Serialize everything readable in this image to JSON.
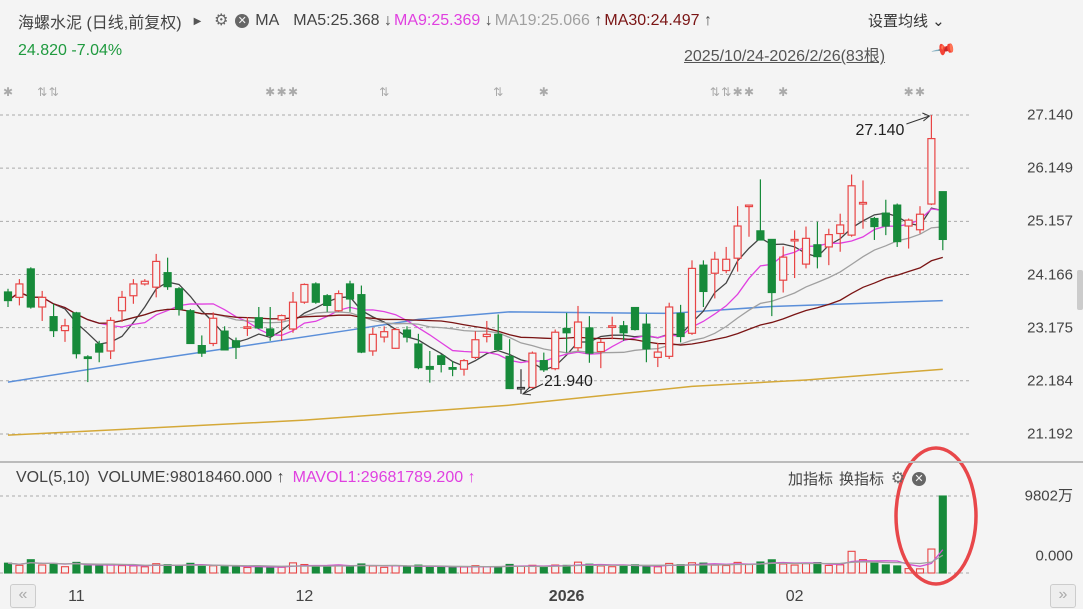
{
  "header": {
    "title": "海螺水泥 (日线,前复权)",
    "indicator": "MA",
    "ma_items": [
      {
        "label": "MA5:25.368",
        "arrow": "↓",
        "color": "#444444"
      },
      {
        "label": "MA9:25.369",
        "arrow": "↓",
        "color": "#e040e0"
      },
      {
        "label": "MA19:25.066",
        "arrow": "↑",
        "color": "#a0a0a0"
      },
      {
        "label": "MA30:24.497",
        "arrow": "↑",
        "color": "#7a1414"
      }
    ],
    "settings": "设置均线 ⌄"
  },
  "quote": {
    "price": "24.820",
    "change": "-7.04%"
  },
  "range": "2025/10/24-2026/2/26(83根)",
  "volume_panel": {
    "title": "VOL(5,10)",
    "volume": "VOLUME:98018460.000",
    "volume_arrow": "↑",
    "mavol": "MAVOL1:29681789.200",
    "mavol_arrow": "↑",
    "add_indicator": "加指标",
    "switch_indicator": "换指标",
    "max_label": "9802万",
    "zero_label": "0.000",
    "max_value": 98018460
  },
  "nav": {
    "prev": "«",
    "next": "»"
  },
  "chart_data": {
    "type": "candlestick",
    "ylim": [
      21.192,
      27.14
    ],
    "y_ticks": [
      "27.140",
      "26.149",
      "25.157",
      "24.166",
      "23.175",
      "22.184",
      "21.192"
    ],
    "x_ticks": [
      {
        "label": "11",
        "date": "2025-11-03"
      },
      {
        "label": "12",
        "date": "2025-12-01"
      },
      {
        "label": "2026",
        "date": "2026-01-05"
      },
      {
        "label": "02",
        "date": "2026-02-02"
      }
    ],
    "ma_periods": [
      5,
      9,
      19,
      30
    ],
    "mavol_periods": [
      5,
      10
    ],
    "colors": {
      "up": "#e84545",
      "down": "#178a3a",
      "ma5": "#444444",
      "ma9": "#e040e0",
      "ma19": "#a0a0a0",
      "ma30": "#7a1414",
      "long_blue": "#5b8fd9",
      "long_gold": "#d4a838",
      "mavol5": "#d050d0",
      "mavol10": "#a0a0a0",
      "highlight": "#e8474a"
    },
    "long_lines": [
      {
        "color": "#5b8fd9",
        "points": [
          [
            "2025-10-24",
            22.16
          ],
          [
            "2025-11-11",
            22.56
          ],
          [
            "2025-12-05",
            23.13
          ],
          [
            "2025-12-15",
            23.33
          ],
          [
            "2025-12-25",
            23.47
          ],
          [
            "2026-01-16",
            23.44
          ],
          [
            "2026-01-29",
            23.57
          ],
          [
            "2026-02-26",
            23.68
          ]
        ]
      },
      {
        "color": "#d4a838",
        "points": [
          [
            "2025-10-24",
            21.17
          ],
          [
            "2025-12-01",
            21.45
          ],
          [
            "2025-12-25",
            21.73
          ],
          [
            "2026-01-20",
            22.08
          ],
          [
            "2026-02-03",
            22.2
          ],
          [
            "2026-02-26",
            22.4
          ]
        ]
      }
    ],
    "annotations": [
      {
        "label": "27.140",
        "date": "2026-02-25",
        "kind": "high"
      },
      {
        "label": "21.940",
        "date": "2025-12-26",
        "kind": "low"
      }
    ],
    "markers": [
      {
        "type": "star",
        "date": "2025-10-24"
      },
      {
        "type": "updown",
        "date": "2025-10-29"
      },
      {
        "type": "updown",
        "date": "2025-10-30"
      },
      {
        "type": "star",
        "date": "2025-11-26"
      },
      {
        "type": "star",
        "date": "2025-11-27"
      },
      {
        "type": "star",
        "date": "2025-11-28"
      },
      {
        "type": "updown",
        "date": "2025-12-10"
      },
      {
        "type": "updown",
        "date": "2025-12-24"
      },
      {
        "type": "star",
        "date": "2025-12-30"
      },
      {
        "type": "updown",
        "date": "2026-01-22"
      },
      {
        "type": "updown",
        "date": "2026-01-23"
      },
      {
        "type": "star",
        "date": "2026-01-26"
      },
      {
        "type": "star",
        "date": "2026-01-27"
      },
      {
        "type": "star",
        "date": "2026-01-30"
      },
      {
        "type": "star",
        "date": "2026-02-23"
      },
      {
        "type": "star",
        "date": "2026-02-24"
      }
    ],
    "candles_fields": [
      "date",
      "open",
      "high",
      "low",
      "close",
      "volume"
    ],
    "candles": [
      [
        "2025-10-24",
        23.84,
        23.9,
        23.56,
        23.68,
        12500000
      ],
      [
        "2025-10-27",
        23.74,
        24.08,
        23.59,
        23.99,
        9800000
      ],
      [
        "2025-10-28",
        24.27,
        24.3,
        23.53,
        23.56,
        16900000
      ],
      [
        "2025-10-29",
        23.56,
        23.86,
        23.3,
        23.74,
        10200000
      ],
      [
        "2025-10-30",
        23.38,
        23.62,
        23.0,
        23.12,
        12100000
      ],
      [
        "2025-10-31",
        23.12,
        23.34,
        22.91,
        23.21,
        8000000
      ],
      [
        "2025-11-03",
        23.45,
        23.47,
        22.6,
        22.69,
        13500000
      ],
      [
        "2025-11-04",
        22.63,
        22.66,
        22.16,
        22.6,
        9100000
      ],
      [
        "2025-11-05",
        22.87,
        22.93,
        22.53,
        22.72,
        8800000
      ],
      [
        "2025-11-06",
        22.74,
        23.37,
        22.59,
        23.31,
        11000000
      ],
      [
        "2025-11-07",
        23.49,
        23.86,
        23.28,
        23.74,
        9400000
      ],
      [
        "2025-11-10",
        23.77,
        24.08,
        23.62,
        23.99,
        9000000
      ],
      [
        "2025-11-11",
        23.99,
        24.08,
        23.96,
        24.04,
        7900000
      ],
      [
        "2025-11-12",
        23.93,
        24.55,
        23.74,
        24.41,
        11800000
      ],
      [
        "2025-11-13",
        24.2,
        24.48,
        23.88,
        23.94,
        10600000
      ],
      [
        "2025-11-14",
        23.9,
        23.93,
        23.4,
        23.52,
        9500000
      ],
      [
        "2025-11-17",
        23.49,
        23.52,
        22.87,
        22.88,
        12300000
      ],
      [
        "2025-11-18",
        22.84,
        23.03,
        22.63,
        22.7,
        8600000
      ],
      [
        "2025-11-19",
        22.88,
        23.46,
        22.83,
        23.35,
        9200000
      ],
      [
        "2025-11-20",
        23.11,
        23.2,
        22.75,
        22.76,
        8100000
      ],
      [
        "2025-11-21",
        22.93,
        22.99,
        22.59,
        22.81,
        7700000
      ],
      [
        "2025-11-24",
        23.17,
        23.37,
        23.02,
        23.19,
        7000000
      ],
      [
        "2025-11-25",
        23.36,
        23.56,
        23.15,
        23.17,
        8500000
      ],
      [
        "2025-11-26",
        23.15,
        23.56,
        22.93,
        23.03,
        7400000
      ],
      [
        "2025-11-27",
        23.32,
        23.42,
        22.93,
        23.4,
        7300000
      ],
      [
        "2025-11-28",
        23.15,
        23.84,
        23.08,
        23.65,
        12900000
      ],
      [
        "2025-12-01",
        23.65,
        24.0,
        23.62,
        23.98,
        10800000
      ],
      [
        "2025-12-02",
        23.99,
        24.02,
        23.62,
        23.65,
        9100000
      ],
      [
        "2025-12-03",
        23.77,
        23.8,
        23.47,
        23.59,
        8300000
      ],
      [
        "2025-12-04",
        23.49,
        23.87,
        23.47,
        23.81,
        10200000
      ],
      [
        "2025-12-05",
        23.99,
        24.05,
        23.47,
        23.71,
        8700000
      ],
      [
        "2025-12-08",
        23.79,
        23.96,
        22.7,
        22.72,
        11500000
      ],
      [
        "2025-12-09",
        22.74,
        23.17,
        22.65,
        23.05,
        8900000
      ],
      [
        "2025-12-10",
        23.0,
        23.2,
        22.9,
        23.1,
        7200000
      ],
      [
        "2025-12-11",
        22.79,
        23.17,
        22.78,
        23.14,
        9000000
      ],
      [
        "2025-12-12",
        23.13,
        23.2,
        22.9,
        23.0,
        8100000
      ],
      [
        "2025-12-15",
        22.87,
        23.06,
        22.4,
        22.43,
        10000000
      ],
      [
        "2025-12-16",
        22.45,
        22.74,
        22.15,
        22.4,
        8000000
      ],
      [
        "2025-12-17",
        22.65,
        22.68,
        22.34,
        22.49,
        7100000
      ],
      [
        "2025-12-18",
        22.43,
        22.55,
        22.27,
        22.4,
        6900000
      ],
      [
        "2025-12-19",
        22.4,
        22.59,
        22.28,
        22.56,
        7600000
      ],
      [
        "2025-12-22",
        22.62,
        23.11,
        22.59,
        22.95,
        9300000
      ],
      [
        "2025-12-23",
        23.01,
        23.3,
        22.9,
        23.05,
        8200000
      ],
      [
        "2025-12-24",
        23.05,
        23.42,
        22.74,
        22.77,
        7800000
      ],
      [
        "2025-12-25",
        22.64,
        22.96,
        22.03,
        22.04,
        10900000
      ],
      [
        "2025-12-26",
        22.06,
        22.4,
        21.94,
        22.06,
        8400000
      ],
      [
        "2025-12-29",
        22.06,
        22.73,
        22.04,
        22.7,
        9800000
      ],
      [
        "2025-12-30",
        22.56,
        22.71,
        22.35,
        22.39,
        7400000
      ],
      [
        "2025-12-31",
        22.41,
        23.14,
        22.38,
        23.09,
        10100000
      ],
      [
        "2026-01-05",
        23.16,
        23.45,
        22.71,
        23.08,
        9700000
      ],
      [
        "2026-01-06",
        22.8,
        23.58,
        22.74,
        23.28,
        13800000
      ],
      [
        "2026-01-07",
        23.17,
        23.39,
        22.52,
        22.7,
        11200000
      ],
      [
        "2026-01-08",
        22.73,
        22.96,
        22.42,
        22.9,
        9000000
      ],
      [
        "2026-01-09",
        23.18,
        23.38,
        22.96,
        23.21,
        8000000
      ],
      [
        "2026-01-12",
        23.21,
        23.3,
        22.93,
        23.08,
        9400000
      ],
      [
        "2026-01-13",
        23.55,
        23.55,
        23.12,
        23.14,
        10500000
      ],
      [
        "2026-01-14",
        23.24,
        23.43,
        22.53,
        22.78,
        8500000
      ],
      [
        "2026-01-15",
        22.62,
        22.89,
        22.44,
        22.72,
        7900000
      ],
      [
        "2026-01-16",
        22.64,
        23.64,
        22.59,
        23.56,
        12200000
      ],
      [
        "2026-01-19",
        23.44,
        23.6,
        22.9,
        23.01,
        10600000
      ],
      [
        "2026-01-20",
        23.07,
        24.43,
        23.04,
        24.28,
        13000000
      ],
      [
        "2026-01-21",
        24.34,
        24.43,
        23.56,
        23.85,
        12600000
      ],
      [
        "2026-01-22",
        24.19,
        24.59,
        23.72,
        24.45,
        10000000
      ],
      [
        "2026-01-23",
        24.24,
        24.68,
        24.19,
        24.45,
        9500000
      ],
      [
        "2026-01-26",
        24.47,
        25.44,
        24.22,
        25.07,
        13500000
      ],
      [
        "2026-01-27",
        25.44,
        25.46,
        24.87,
        25.46,
        10800000
      ],
      [
        "2026-01-28",
        24.98,
        25.94,
        24.81,
        24.81,
        14000000
      ],
      [
        "2026-01-29",
        24.82,
        24.82,
        23.39,
        23.83,
        16800000
      ],
      [
        "2026-01-30",
        24.06,
        24.69,
        23.83,
        24.49,
        11500000
      ],
      [
        "2026-02-02",
        24.81,
        24.99,
        24.1,
        24.82,
        10100000
      ],
      [
        "2026-02-03",
        24.36,
        25.06,
        24.28,
        24.84,
        11900000
      ],
      [
        "2026-02-04",
        24.72,
        25.15,
        24.28,
        24.5,
        13200000
      ],
      [
        "2026-02-05",
        24.68,
        25.02,
        24.34,
        24.91,
        9600000
      ],
      [
        "2026-02-06",
        24.93,
        25.3,
        24.59,
        25.09,
        10400000
      ],
      [
        "2026-02-09",
        24.9,
        26.03,
        24.87,
        25.82,
        27600000
      ],
      [
        "2026-02-10",
        25.48,
        25.92,
        25.02,
        25.51,
        17000000
      ],
      [
        "2026-02-11",
        25.21,
        25.24,
        24.81,
        25.06,
        12500000
      ],
      [
        "2026-02-12",
        25.31,
        25.56,
        24.9,
        25.07,
        10300000
      ],
      [
        "2026-02-13",
        25.46,
        25.49,
        24.68,
        24.78,
        9000000
      ],
      [
        "2026-02-23",
        25.07,
        25.21,
        24.65,
        25.18,
        5600000
      ],
      [
        "2026-02-24",
        25.0,
        25.44,
        24.93,
        25.29,
        5300000
      ],
      [
        "2026-02-25",
        25.48,
        27.14,
        25.46,
        26.7,
        30500000
      ],
      [
        "2026-02-26",
        25.71,
        25.71,
        24.62,
        24.82,
        98018460
      ]
    ]
  }
}
